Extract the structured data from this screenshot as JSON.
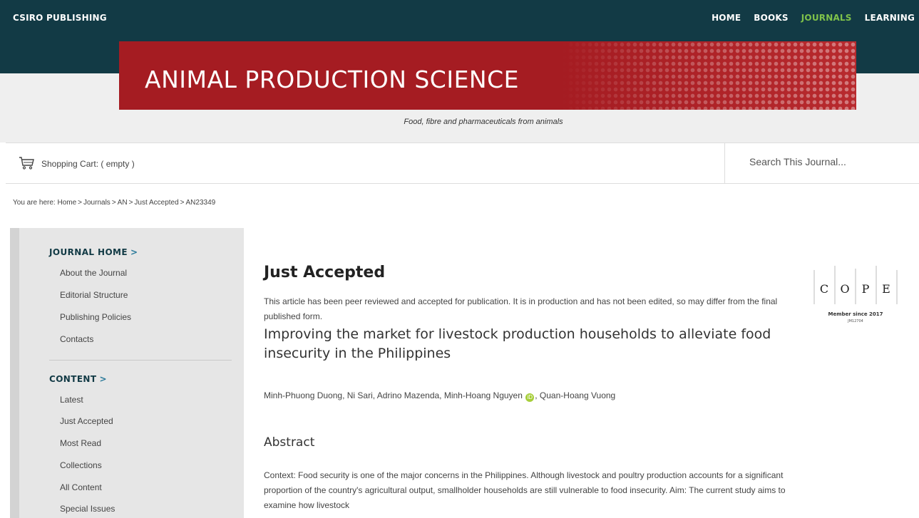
{
  "header": {
    "brand": "CSIRO PUBLISHING",
    "nav": [
      {
        "label": "HOME",
        "active": false
      },
      {
        "label": "BOOKS",
        "active": false
      },
      {
        "label": "JOURNALS",
        "active": true
      },
      {
        "label": "LEARNING",
        "active": false
      }
    ],
    "accent_color": "#7fc24a"
  },
  "banner": {
    "title": "ANIMAL PRODUCTION SCIENCE",
    "tagline": "Food, fibre and pharmaceuticals from animals",
    "color": "#a51c22"
  },
  "toolbar": {
    "cart_label": "Shopping Cart: ( empty )",
    "cart_icon": "shopping-cart-icon",
    "search_placeholder": "Search This Journal..."
  },
  "breadcrumb": [
    "You are here:",
    "Home",
    "Journals",
    "AN",
    "Just Accepted",
    "AN23349"
  ],
  "sidebar": {
    "sections": [
      {
        "heading": "JOURNAL HOME",
        "items": [
          "About the Journal",
          "Editorial Structure",
          "Publishing Policies",
          "Contacts"
        ]
      },
      {
        "heading": "CONTENT",
        "items": [
          "Latest",
          "Just Accepted",
          "Most Read",
          "Collections",
          "All Content",
          "Special Issues"
        ]
      }
    ]
  },
  "main": {
    "heading": "Just Accepted",
    "notice": "This article has been peer reviewed and accepted for publication. It is in production and has not been edited, so may differ from the final published form.",
    "cope": {
      "letters": [
        "C",
        "O",
        "P",
        "E"
      ],
      "member": "Member since 2017",
      "id": "JM12704"
    },
    "article_title": "Improving the market for livestock production households to alleviate food insecurity in the Philippines",
    "authors": [
      "Minh-Phuong Duong",
      "Ni Sari",
      "Adrino Mazenda",
      "Minh-Hoang Nguyen",
      "Quan-Hoang Vuong"
    ],
    "orcid_author_index": 3,
    "abstract_heading": "Abstract",
    "abstract": "Context: Food security is one of the major concerns in the Philippines. Although livestock and poultry production accounts for a significant proportion of the country's agricultural output, smallholder households are still vulnerable to food insecurity. Aim: The current study aims to examine how livestock"
  }
}
